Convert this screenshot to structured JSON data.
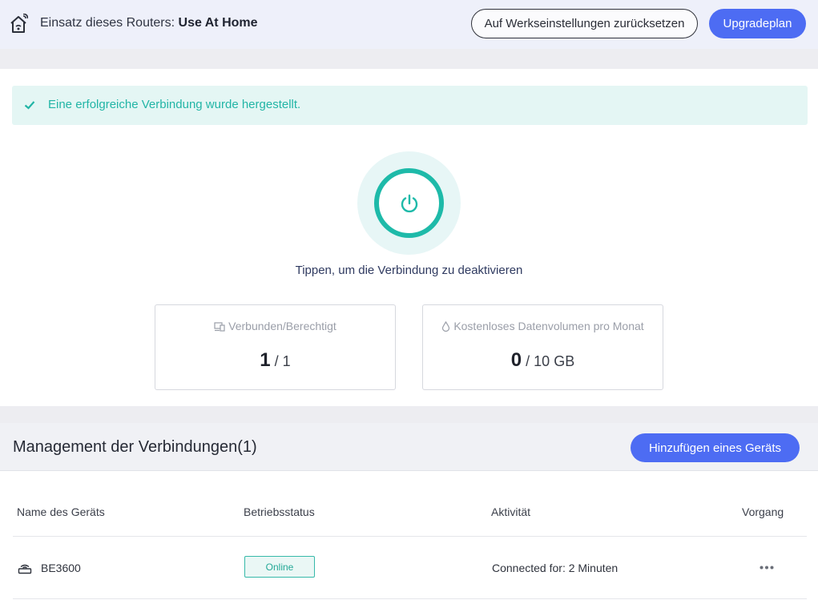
{
  "header": {
    "usage_label": "Einsatz dieses Routers:",
    "usage_value": "Use At Home",
    "reset_label": "Auf Werkseinstellungen zurücksetzen",
    "upgrade_label": "Upgradeplan"
  },
  "status": {
    "success_message": "Eine erfolgreiche Verbindung wurde hergestellt.",
    "power_hint": "Tippen, um die Verbindung zu deaktivieren"
  },
  "stats": {
    "devices": {
      "label": "Verbunden/Berechtigt",
      "current": "1",
      "total": "/ 1"
    },
    "data": {
      "label": "Kostenloses Datenvolumen pro Monat",
      "current": "0",
      "total": "/ 10 GB"
    }
  },
  "management": {
    "title": "Management der Verbindungen(1)",
    "add_label": "Hinzufügen eines Geräts",
    "columns": [
      "Name des Geräts",
      "Betriebsstatus",
      "Aktivität",
      "Vorgang"
    ],
    "rows": [
      {
        "name": "BE3600",
        "status": "Online",
        "activity": "Connected for: 2 Minuten"
      }
    ]
  },
  "colors": {
    "accent": "#4d6cf3",
    "success": "#1ebaa9"
  },
  "icons": [
    "home-wifi-icon",
    "check-icon",
    "power-icon",
    "devices-icon",
    "droplet-icon",
    "router-icon",
    "more-icon"
  ]
}
